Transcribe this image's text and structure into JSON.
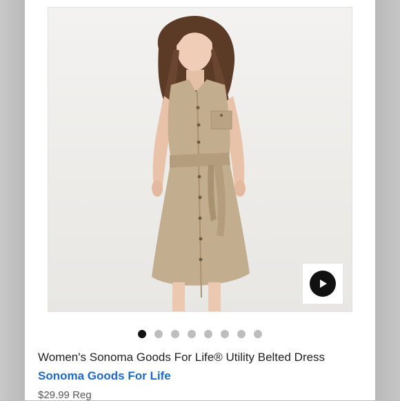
{
  "product": {
    "title": "Women's Sonoma Goods For Life® Utility Belted Dress",
    "brand": "Sonoma Goods For Life",
    "price": "$29.99",
    "price_type": "Reg"
  },
  "gallery": {
    "image_count": 8,
    "active_index": 0,
    "has_video": true
  },
  "colors": {
    "brand_link": "#2169c7",
    "dot_active": "#111111",
    "dot_inactive": "#bdbdbd",
    "dress": "#c2ad8e"
  },
  "icons": {
    "video": "play-icon"
  }
}
